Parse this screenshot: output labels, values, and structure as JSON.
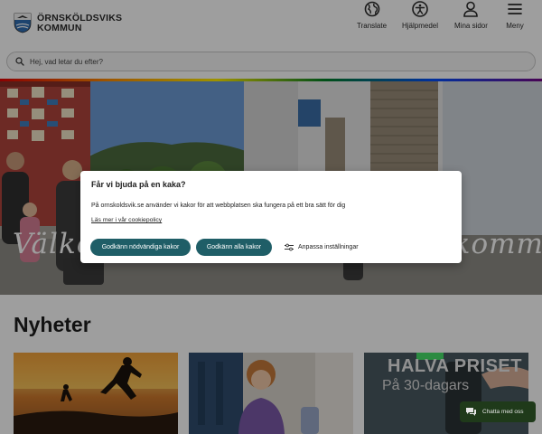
{
  "header": {
    "logo_line1": "ÖRNSKÖLDSVIKS",
    "logo_line2": "KOMMUN",
    "nav": {
      "translate": "Translate",
      "accessibility": "Hjälpmedel",
      "my_pages": "Mina sidor",
      "menu": "Meny"
    }
  },
  "search": {
    "placeholder": "Hej, vad letar du efter?"
  },
  "hero": {
    "title": "Välkommen till Örnsköldsvik kommun"
  },
  "news": {
    "heading": "Nyheter",
    "card3_title": "HALVA PRISET",
    "card3_subtitle": "På 30-dagars"
  },
  "cookie_dialog": {
    "title": "Får vi bjuda på en kaka?",
    "text": "På ornskoldsvik.se använder vi kakor för att webbplatsen ska fungera på ett bra sätt för dig",
    "policy_link": "Läs mer i vår cookiepolicy",
    "btn_necessary": "Godkänn nödvändiga kakor",
    "btn_all": "Godkänn alla kakor",
    "btn_customize": "Anpassa inställningar"
  },
  "chat": {
    "label": "Chatta med oss"
  },
  "colors": {
    "primary_button": "#1f5e67",
    "chat_bg": "#1f3a1a"
  }
}
